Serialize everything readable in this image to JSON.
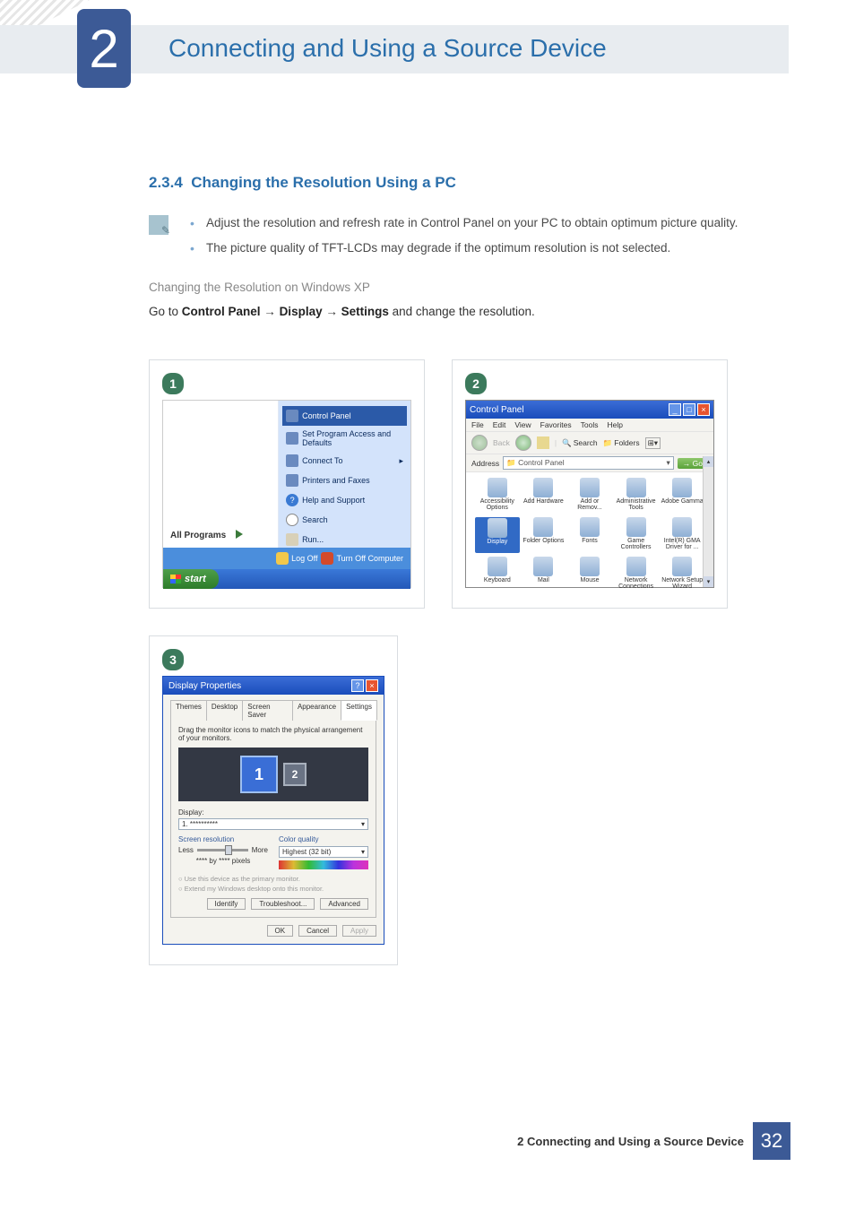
{
  "chapter": {
    "number": "2",
    "title": "Connecting and Using a Source Device"
  },
  "section": {
    "number": "2.3.4",
    "title": "Changing the Resolution Using a PC"
  },
  "notes": [
    "Adjust the resolution and refresh rate in Control Panel on your PC to obtain optimum picture quality.",
    "The picture quality of TFT-LCDs may degrade if the optimum resolution is not selected."
  ],
  "subheading": "Changing the Resolution on Windows XP",
  "instruction": {
    "prefix": "Go to ",
    "p1": "Control Panel",
    "arrow": " → ",
    "p2": "Display",
    "p3": "Settings",
    "suffix": " and change the resolution."
  },
  "shot1": {
    "badge": "1",
    "allPrograms": "All Programs",
    "items": [
      "Control Panel",
      "Set Program Access and Defaults",
      "Connect To",
      "Printers and Faxes",
      "Help and Support",
      "Search",
      "Run..."
    ],
    "logOff": "Log Off",
    "turnOff": "Turn Off Computer",
    "start": "start"
  },
  "shot2": {
    "badge": "2",
    "title": "Control Panel",
    "menus": [
      "File",
      "Edit",
      "View",
      "Favorites",
      "Tools",
      "Help"
    ],
    "back": "Back",
    "search": "Search",
    "folders": "Folders",
    "addressLabel": "Address",
    "address": "Control Panel",
    "go": "Go",
    "icons": [
      "Accessibility Options",
      "Add Hardware",
      "Add or Remov...",
      "Administrative Tools",
      "Adobe Gamma",
      "Display",
      "Folder Options",
      "Fonts",
      "Game Controllers",
      "Intel(R) GMA Driver for ...",
      "Keyboard",
      "Mail",
      "Mouse",
      "Network Connections",
      "Network Setup Wizard"
    ],
    "selectedIndex": 5
  },
  "shot3": {
    "badge": "3",
    "title": "Display Properties",
    "tabs": [
      "Themes",
      "Desktop",
      "Screen Saver",
      "Appearance",
      "Settings"
    ],
    "activeTab": 4,
    "hint": "Drag the monitor icons to match the physical arrangement of your monitors.",
    "mon1": "1",
    "mon2": "2",
    "displayLabel": "Display:",
    "displayValue": "1. **********",
    "resolutionLabel": "Screen resolution",
    "less": "Less",
    "more": "More",
    "resValue": "**** by **** pixels",
    "cqLabel": "Color quality",
    "cqValue": "Highest (32 bit)",
    "chk1": "Use this device as the primary monitor.",
    "chk2": "Extend my Windows desktop onto this monitor.",
    "identify": "Identify",
    "troubleshoot": "Troubleshoot...",
    "advanced": "Advanced",
    "ok": "OK",
    "cancel": "Cancel",
    "apply": "Apply"
  },
  "footer": {
    "chapter": "2",
    "title": "Connecting and Using a Source Device",
    "page": "32"
  }
}
